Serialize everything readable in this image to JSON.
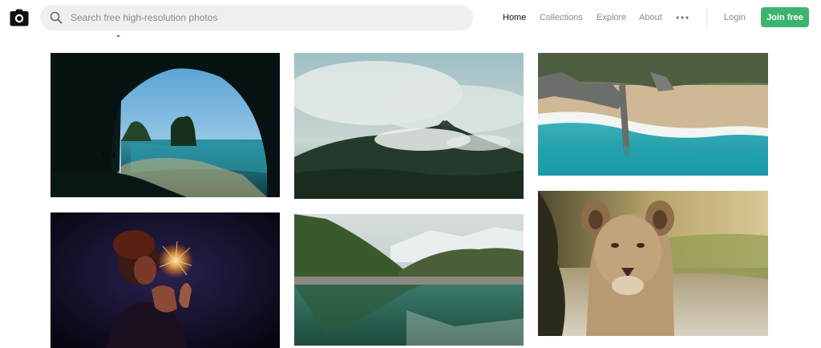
{
  "header": {
    "search": {
      "placeholder": "Search free high-resolution photos",
      "value": ""
    },
    "nav": [
      {
        "label": "Home",
        "active": true
      },
      {
        "label": "Collections",
        "active": false
      },
      {
        "label": "Explore",
        "active": false
      },
      {
        "label": "About",
        "active": false
      }
    ],
    "login_label": "Login",
    "join_label": "Join free",
    "icons": {
      "logo": "camera-icon",
      "search": "search-icon",
      "more": "more-dots-icon"
    },
    "colors": {
      "join_button": "#3cb46e",
      "active_nav": "#111111",
      "inactive_nav": "#8a8a8a"
    }
  },
  "gallery": {
    "columns": [
      {
        "photos": [
          {
            "subject": "sea cave arch overlooking beach and rock"
          },
          {
            "subject": "person holding a sparkler"
          }
        ]
      },
      {
        "photos": [
          {
            "subject": "misty mountain peak above forest"
          },
          {
            "subject": "mountain lake reflection"
          }
        ]
      },
      {
        "photos": [
          {
            "subject": "aerial view of beach and surf"
          },
          {
            "subject": "lioness portrait"
          }
        ]
      }
    ]
  }
}
